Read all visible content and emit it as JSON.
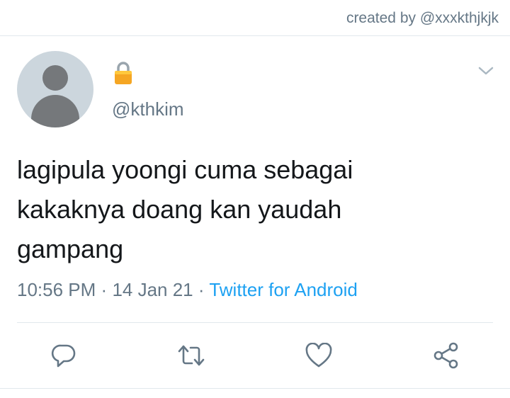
{
  "credit": {
    "text": "created by @xxxkthjkjk"
  },
  "tweet": {
    "handle": "@kthkim",
    "text": "lagipula yoongi cuma sebagai\nkakaknya doang kan yaudah\ngampang",
    "time": "10:56 PM",
    "separator": "·",
    "date": "14 Jan 21",
    "source": "Twitter for Android"
  },
  "icons": {
    "lock": "lock-icon",
    "chevron": "chevron-down-icon",
    "reply": "reply-icon",
    "retweet": "retweet-icon",
    "like": "heart-icon",
    "share": "share-icon"
  },
  "colors": {
    "text": "#14171a",
    "secondary": "#657786",
    "link": "#1da1f2",
    "divider": "#e1e8ed",
    "avatar_bg": "#ccd6dd",
    "avatar_fg": "#75787b"
  }
}
